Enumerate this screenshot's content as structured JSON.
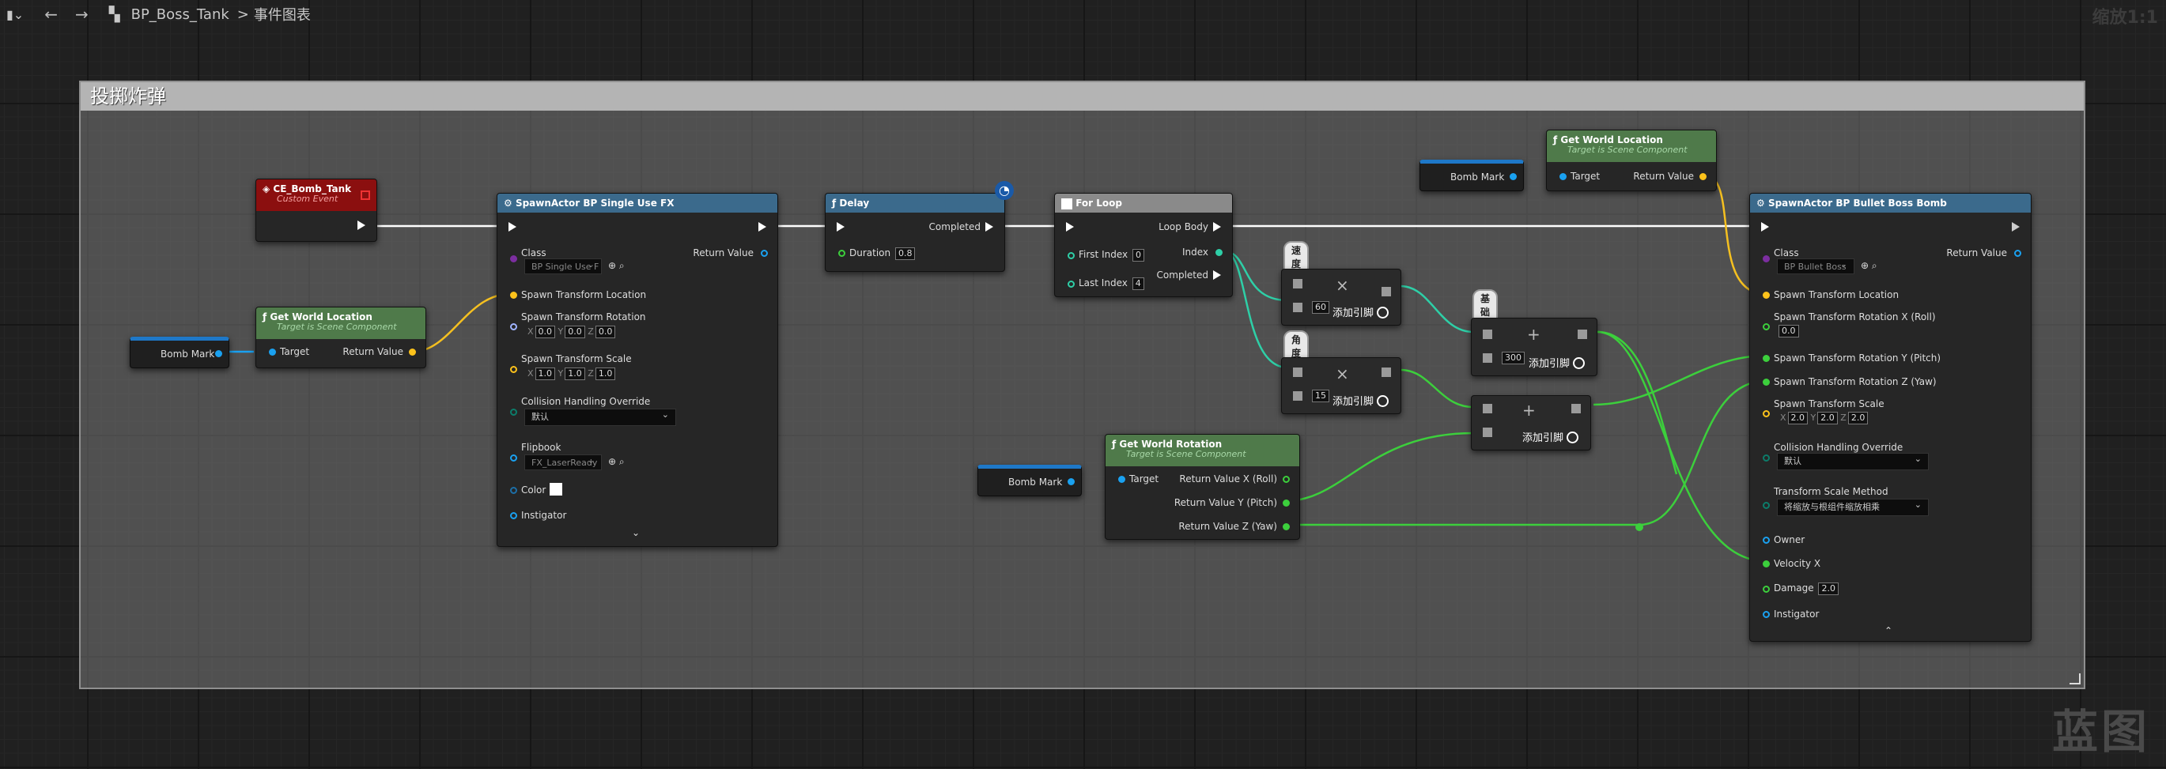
{
  "toolbar": {
    "back_icon": "arrow-left-icon",
    "forward_icon": "arrow-right-icon",
    "blueprint_name": "BP_Boss_Tank",
    "separator": ">",
    "graph_name": "事件图表",
    "zoom": "缩放1:1"
  },
  "watermark": "蓝图",
  "comment_title": "投掷炸弹",
  "nodes": {
    "custom_event": {
      "title": "CE_Bomb_Tank",
      "subtitle": "Custom Event"
    },
    "get_world_location_1": {
      "title": "Get World Location",
      "subtitle": "Target is Scene Component",
      "target": "Target",
      "return": "Return Value"
    },
    "bomb_mark_1": {
      "label": "Bomb Mark"
    },
    "spawn_fx": {
      "title": "SpawnActor BP Single Use FX",
      "class_label": "Class",
      "class_value": "BP Single Use F",
      "return": "Return Value",
      "loc": "Spawn Transform Location",
      "rot": "Spawn Transform Rotation",
      "rot_x": "0.0",
      "rot_y": "0.0",
      "rot_z": "0.0",
      "scale": "Spawn Transform Scale",
      "scale_x": "1.0",
      "scale_y": "1.0",
      "scale_z": "1.0",
      "collision": "Collision Handling Override",
      "collision_value": "默认",
      "flipbook": "Flipbook",
      "flipbook_value": "FX_LaserReady",
      "color": "Color",
      "instigator": "Instigator",
      "axis_x": "X",
      "axis_y": "Y",
      "axis_z": "Z"
    },
    "delay": {
      "title": "Delay",
      "completed": "Completed",
      "duration": "Duration",
      "duration_value": "0.8"
    },
    "for_loop": {
      "title": "For Loop",
      "loop_body": "Loop Body",
      "first": "First Index",
      "first_value": "0",
      "last": "Last Index",
      "last_value": "4",
      "index": "Index",
      "completed": "Completed"
    },
    "mul_1": {
      "bubble": "速度乘数",
      "value": "60",
      "add_pin": "添加引脚"
    },
    "mul_2": {
      "bubble": "角度乘数",
      "value": "15",
      "add_pin": "添加引脚"
    },
    "add_1": {
      "bubble": "基础速度",
      "value": "300",
      "add_pin": "添加引脚"
    },
    "add_2": {
      "add_pin": "添加引脚"
    },
    "bomb_mark_2": {
      "label": "Bomb Mark"
    },
    "get_world_rotation": {
      "title": "Get World Rotation",
      "subtitle": "Target is Scene Component",
      "target": "Target",
      "roll": "Return Value X (Roll)",
      "pitch": "Return Value Y (Pitch)",
      "yaw": "Return Value Z (Yaw)"
    },
    "bomb_mark_3": {
      "label": "Bomb Mark"
    },
    "get_world_location_2": {
      "title": "Get World Location",
      "subtitle": "Target is Scene Component",
      "target": "Target",
      "return": "Return Value"
    },
    "spawn_bomb": {
      "title": "SpawnActor BP Bullet Boss Bomb",
      "class_label": "Class",
      "class_value": "BP Bullet Boss",
      "return": "Return Value",
      "loc": "Spawn Transform Location",
      "rot_x": "Spawn Transform Rotation X (Roll)",
      "rot_x_value": "0.0",
      "rot_y": "Spawn Transform Rotation Y (Pitch)",
      "rot_z": "Spawn Transform Rotation Z (Yaw)",
      "scale": "Spawn Transform Scale",
      "scale_x": "2.0",
      "scale_y": "2.0",
      "scale_z": "2.0",
      "collision": "Collision Handling Override",
      "collision_value": "默认",
      "scale_method": "Transform Scale Method",
      "scale_method_value": "将缩放与根组件缩放相乘",
      "owner": "Owner",
      "velocity": "Velocity X",
      "damage": "Damage",
      "damage_value": "2.0",
      "instigator": "Instigator",
      "axis_x": "X",
      "axis_y": "Y",
      "axis_z": "Z"
    }
  },
  "colors": {
    "exec": "#ffffff",
    "object": "#1aa1f0",
    "vector": "#fcc21b",
    "rotator": "#a0b4ff",
    "float": "#3ccf3c",
    "int": "#2ecfa7",
    "class": "#7c2ea0",
    "struct": "#1c6fa8"
  }
}
